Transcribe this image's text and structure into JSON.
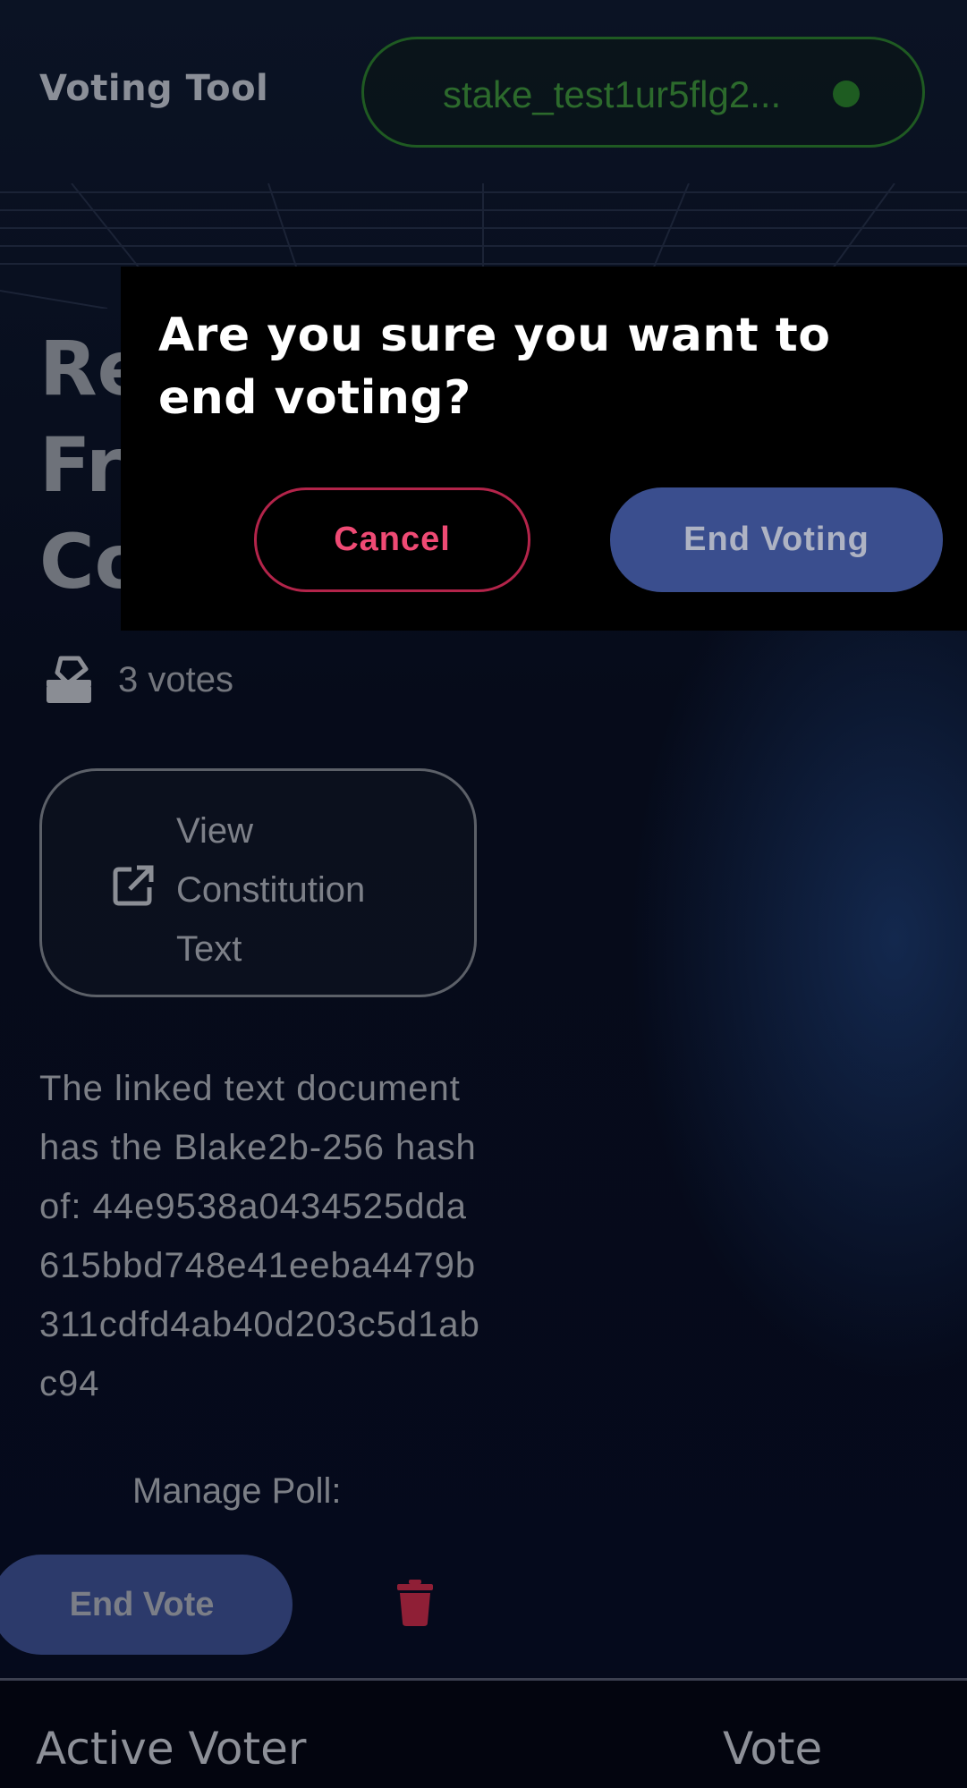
{
  "app": {
    "title": "Voting Tool"
  },
  "wallet": {
    "address": "stake_test1ur5flg2...",
    "status_color": "#1e5c21"
  },
  "poll": {
    "title_visible": "Re\nFr\nCo",
    "votes_count": "3 votes",
    "view_button_label": "View Constitution Text",
    "hash_text": "The linked text document has the Blake2b-256 hash of: 44e9538a0434525dda615bbd748e41eeba4479b311cdfd4ab40d203c5d1abc94",
    "manage_label": "Manage Poll:",
    "end_vote_label": "End Vote"
  },
  "table": {
    "columns": [
      "Active Voter",
      "Vote"
    ]
  },
  "modal": {
    "title": "Are you sure you want to end voting?",
    "cancel_label": "Cancel",
    "confirm_label": "End Voting"
  },
  "colors": {
    "accent_blue": "#3a4e8e",
    "danger": "#ef4a74",
    "wallet_green": "#1f5a22"
  },
  "icons": {
    "votes": "ballot-box-icon",
    "view": "external-link-icon",
    "delete": "trash-icon",
    "status": "connected-dot-icon"
  }
}
